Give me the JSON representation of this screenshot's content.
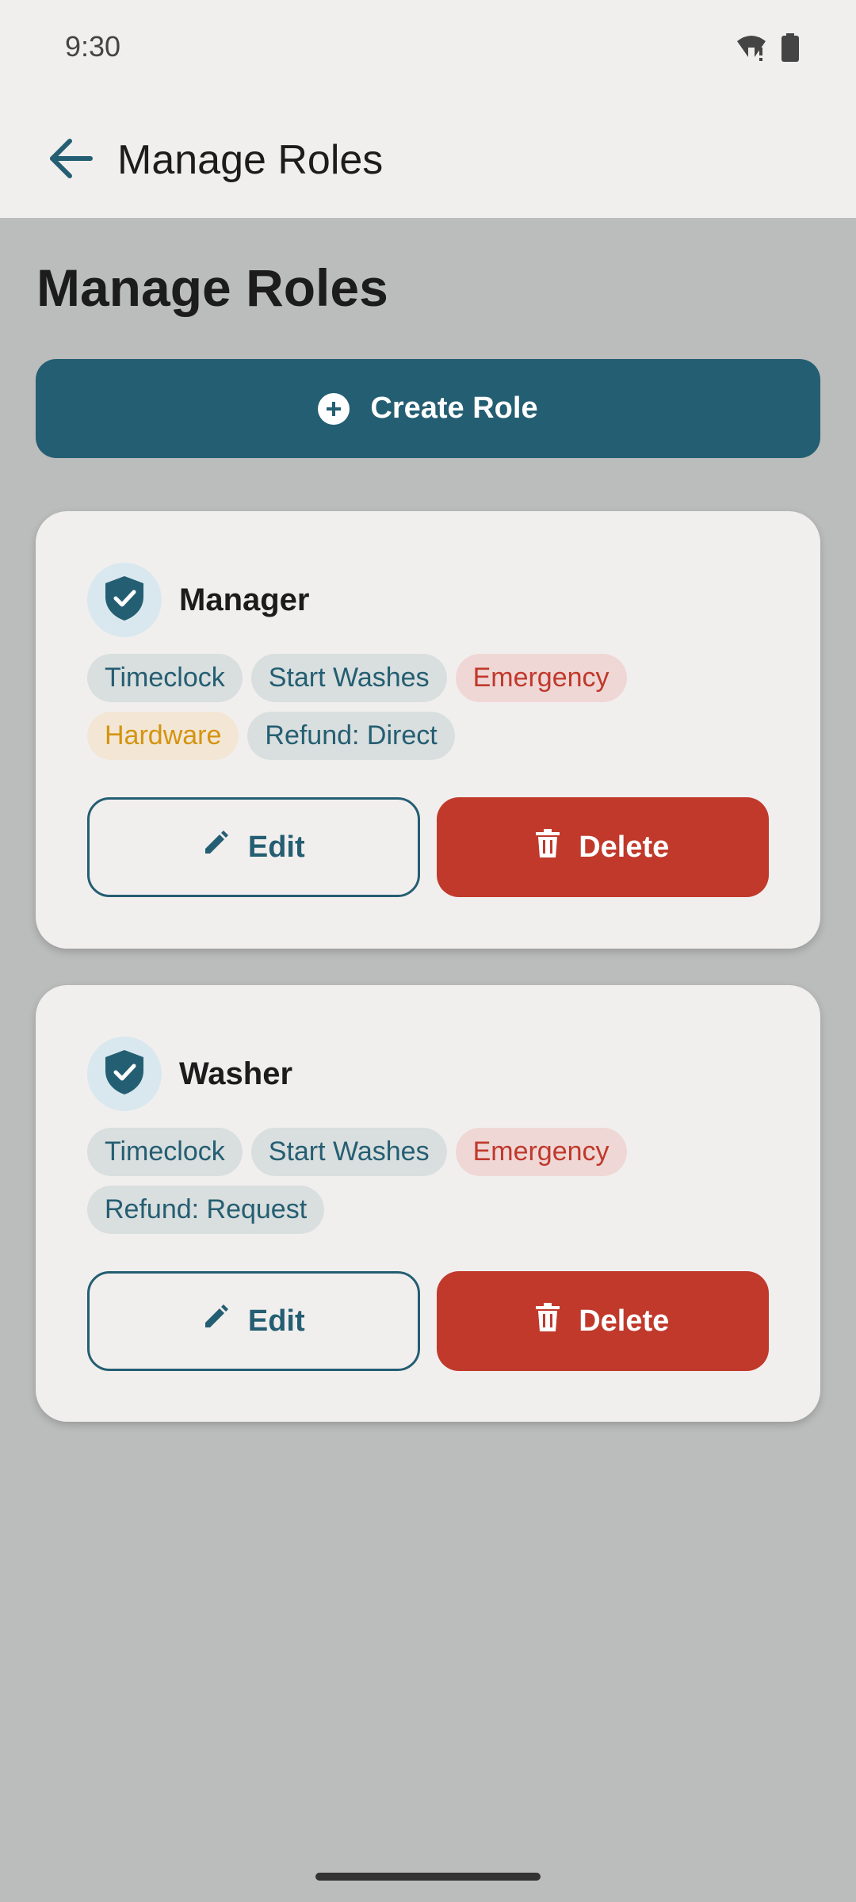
{
  "status_bar": {
    "time": "9:30",
    "icons": [
      "wifi-alert-icon",
      "battery-icon"
    ]
  },
  "app_bar": {
    "title": "Manage Roles",
    "back_icon": "arrow-back-icon"
  },
  "page": {
    "heading": "Manage Roles",
    "create_label": "Create Role",
    "create_icon": "add-circle-icon"
  },
  "colors": {
    "primary": "#245e72",
    "danger": "#c0392b",
    "warning": "#d4940f",
    "background": "#bbbcbc",
    "surface": "#f1efee"
  },
  "roles": [
    {
      "name": "Manager",
      "icon": "shield-check-icon",
      "permissions": [
        {
          "label": "Timeclock",
          "tone": "neutral"
        },
        {
          "label": "Start Washes",
          "tone": "neutral"
        },
        {
          "label": "Emergency",
          "tone": "danger"
        },
        {
          "label": "Hardware",
          "tone": "warning"
        },
        {
          "label": "Refund: Direct",
          "tone": "neutral"
        }
      ],
      "edit_label": "Edit",
      "delete_label": "Delete"
    },
    {
      "name": "Washer",
      "icon": "shield-check-icon",
      "permissions": [
        {
          "label": "Timeclock",
          "tone": "neutral"
        },
        {
          "label": "Start Washes",
          "tone": "neutral"
        },
        {
          "label": "Emergency",
          "tone": "danger"
        },
        {
          "label": "Refund: Request",
          "tone": "neutral"
        }
      ],
      "edit_label": "Edit",
      "delete_label": "Delete"
    }
  ]
}
